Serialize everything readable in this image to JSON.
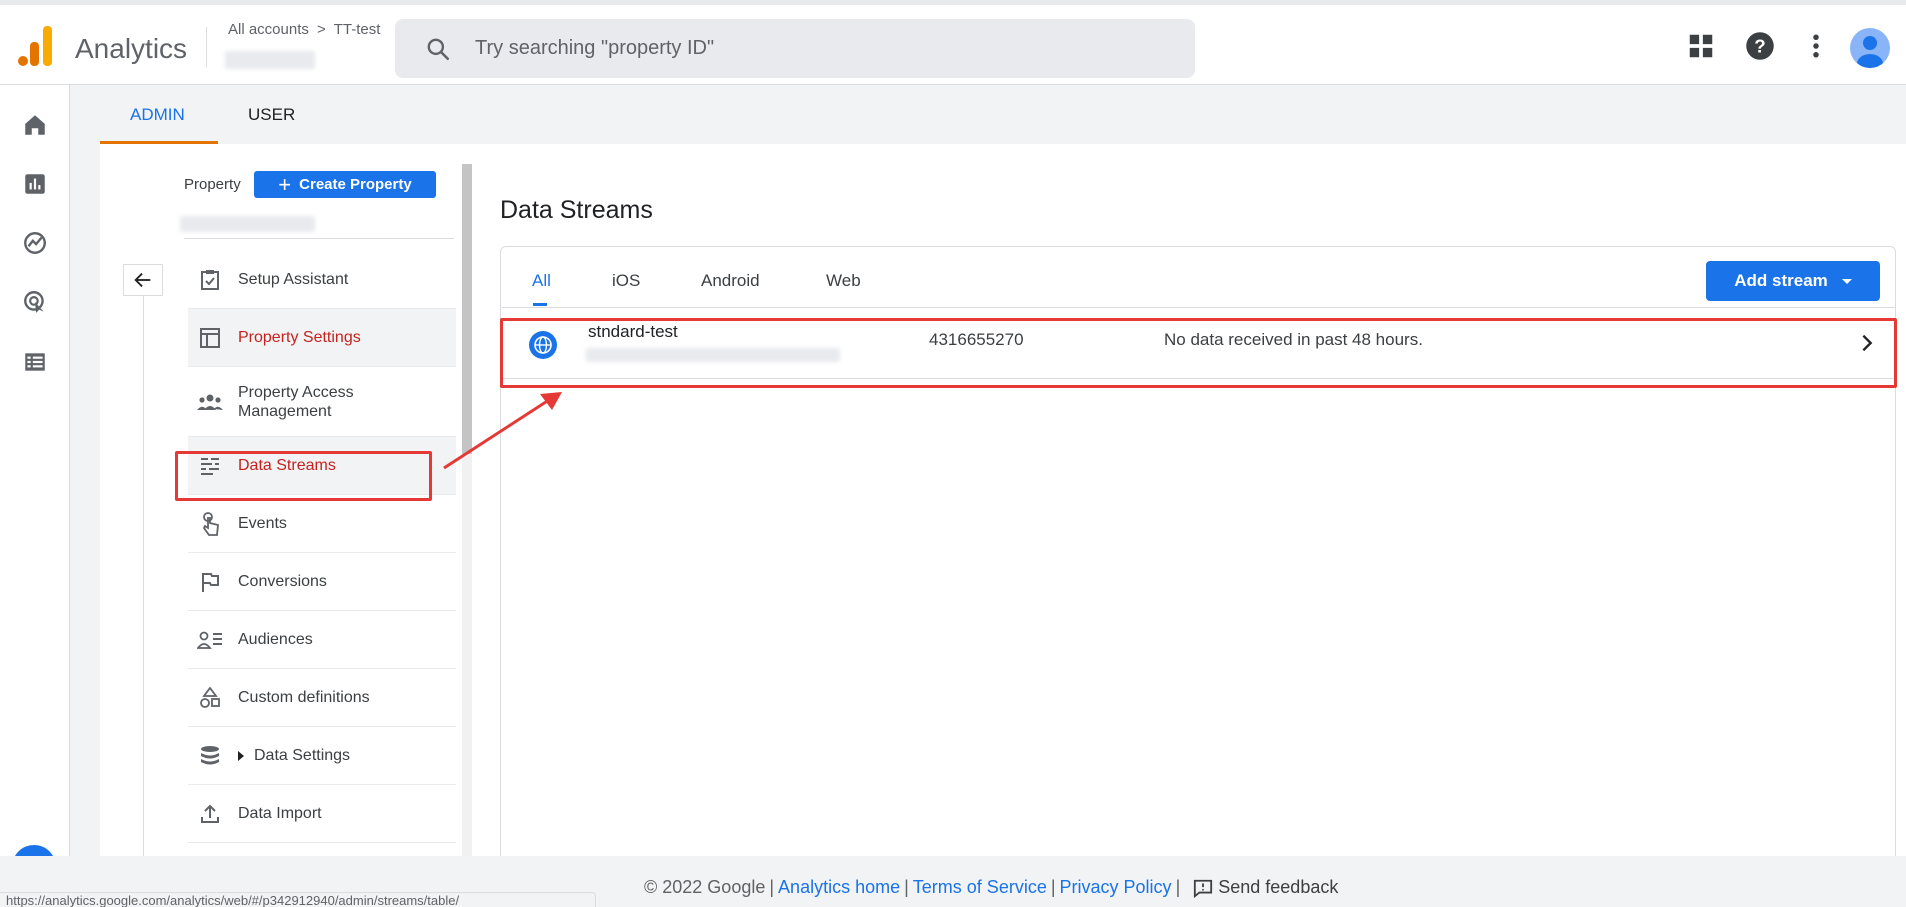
{
  "header": {
    "app_title": "Analytics",
    "crumb_all_accounts": "All accounts",
    "crumb_sep": ">",
    "crumb_account": "TT-test",
    "search_placeholder": "Try searching \"property ID\"",
    "icons": [
      "apps-grid-icon",
      "help-icon",
      "more-vert-icon",
      "avatar"
    ]
  },
  "leftnav": {
    "icons": [
      "home-icon",
      "reports-icon",
      "explore-icon",
      "advertising-icon",
      "configure-icon"
    ],
    "admin_icon": "gear-icon"
  },
  "tabs": {
    "admin": "ADMIN",
    "user": "USER"
  },
  "property": {
    "label": "Property",
    "create_button": "Create Property",
    "menu": [
      {
        "label": "Setup Assistant",
        "icon": "checklist-icon"
      },
      {
        "label": "Property Settings",
        "icon": "layout-icon"
      },
      {
        "label": "Property Access Management",
        "icon": "people-icon"
      },
      {
        "label": "Data Streams",
        "icon": "streams-icon"
      },
      {
        "label": "Events",
        "icon": "touch-icon"
      },
      {
        "label": "Conversions",
        "icon": "flag-icon"
      },
      {
        "label": "Audiences",
        "icon": "audience-icon"
      },
      {
        "label": "Custom definitions",
        "icon": "shapes-icon"
      },
      {
        "label": "Data Settings",
        "icon": "database-icon"
      },
      {
        "label": "Data Import",
        "icon": "upload-icon"
      }
    ]
  },
  "data_streams": {
    "title": "Data Streams",
    "filters": [
      "All",
      "iOS",
      "Android",
      "Web"
    ],
    "add_stream": "Add stream",
    "rows": [
      {
        "name": "stndard-test",
        "id": "4316655270",
        "status": "No data received in past 48 hours."
      }
    ]
  },
  "footer": {
    "copyright": "© 2022 Google",
    "links": [
      "Analytics home",
      "Terms of Service",
      "Privacy Policy"
    ],
    "feedback": "Send feedback",
    "sep": "|"
  },
  "status_bar": {
    "url": "https://analytics.google.com/analytics/web/#/p342912940/admin/streams/table/"
  },
  "colors": {
    "primary": "#1a73e8",
    "accent_orange": "#e37400",
    "selected_red": "#c5221f",
    "annotation_red": "#e53935"
  }
}
